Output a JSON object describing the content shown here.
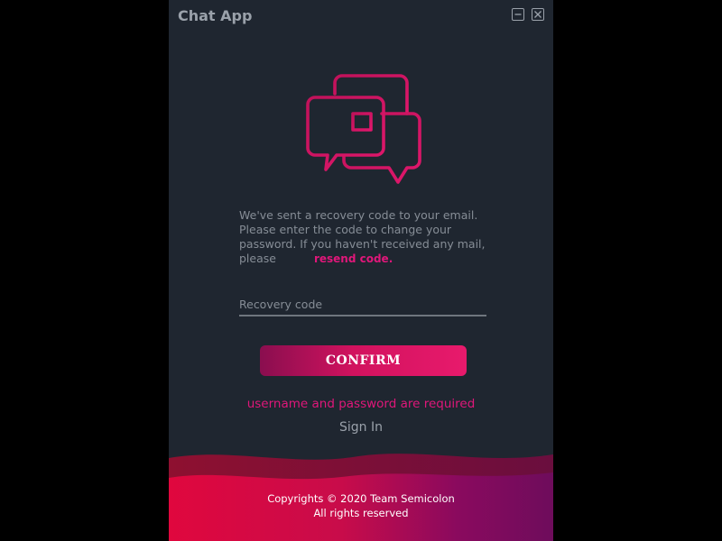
{
  "window": {
    "title": "Chat App",
    "minimize_icon": "minimize-icon",
    "close_icon": "close-icon"
  },
  "logo": {
    "icon": "chat-bubbles-icon",
    "color": "#d4145f"
  },
  "message": {
    "text": "We've sent a recovery code to your email. Please enter the code to change your password. If you haven't received any mail, please",
    "resend_link": "resend code."
  },
  "recovery_code": {
    "placeholder": "Recovery code",
    "value": ""
  },
  "confirm_label": "CONFIRM",
  "error_text": "username and password are required",
  "sign_in_label": "Sign In",
  "footer": {
    "line1": "Copyrights © 2020 Team Semicolon",
    "line2": "All rights reserved"
  },
  "colors": {
    "background": "#1f2630",
    "accent": "#e0177a",
    "text_muted": "#868d96"
  }
}
